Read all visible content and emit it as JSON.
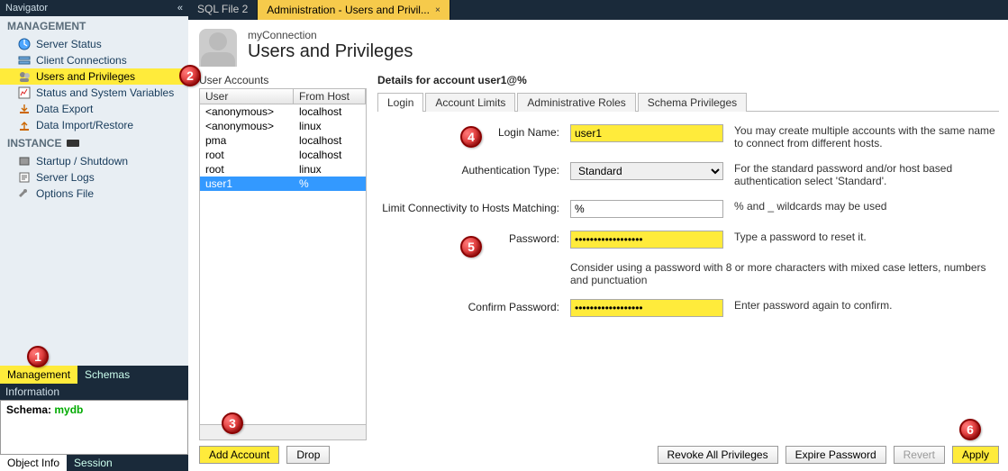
{
  "tabs": {
    "doc1": "SQL File 2",
    "doc2": "Administration - Users and Privil..."
  },
  "sidebar": {
    "title": "Navigator",
    "groups": {
      "management": "MANAGEMENT",
      "instance": "INSTANCE"
    },
    "items": {
      "server_status": "Server Status",
      "client_conn": "Client Connections",
      "users_privs": "Users and Privileges",
      "status_vars": "Status and System Variables",
      "data_export": "Data Export",
      "data_import": "Data Import/Restore",
      "startup": "Startup / Shutdown",
      "server_logs": "Server Logs",
      "options_file": "Options File"
    },
    "navtabs": {
      "management": "Management",
      "schemas": "Schemas"
    },
    "info_header": "Information",
    "info_label": "Schema:",
    "info_value": "mydb",
    "bottom": {
      "object_info": "Object Info",
      "session": "Session"
    }
  },
  "header": {
    "connection": "myConnection",
    "title": "Users and Privileges"
  },
  "accounts": {
    "label": "User Accounts",
    "columns": {
      "user": "User",
      "host": "From Host"
    },
    "rows": [
      {
        "user": "<anonymous>",
        "host": "localhost"
      },
      {
        "user": "<anonymous>",
        "host": "linux"
      },
      {
        "user": "pma",
        "host": "localhost"
      },
      {
        "user": "root",
        "host": "localhost"
      },
      {
        "user": "root",
        "host": "linux"
      },
      {
        "user": "user1",
        "host": "%"
      }
    ],
    "add_btn": "Add Account",
    "drop_btn": "Drop"
  },
  "details": {
    "title": "Details for account user1@%",
    "tabs": {
      "login": "Login",
      "limits": "Account Limits",
      "roles": "Administrative Roles",
      "schema": "Schema Privileges"
    },
    "fields": {
      "login_name": {
        "label": "Login Name:",
        "value": "user1",
        "hint": "You may create multiple accounts with the same name to connect from different hosts."
      },
      "auth_type": {
        "label": "Authentication Type:",
        "value": "Standard",
        "hint": "For the standard password and/or host based authentication select 'Standard'."
      },
      "host_match": {
        "label": "Limit Connectivity to Hosts Matching:",
        "value": "%",
        "hint": "% and _ wildcards may be used"
      },
      "password": {
        "label": "Password:",
        "value": "******************",
        "hint": "Type a password to reset it."
      },
      "password_note": "Consider using a password with 8 or more characters with mixed case letters, numbers and punctuation",
      "confirm": {
        "label": "Confirm Password:",
        "value": "******************",
        "hint": "Enter password again to confirm."
      }
    },
    "actions": {
      "revoke": "Revoke All Privileges",
      "expire": "Expire Password",
      "revert": "Revert",
      "apply": "Apply"
    }
  },
  "badges": {
    "b1": "1",
    "b2": "2",
    "b3": "3",
    "b4": "4",
    "b5": "5",
    "b6": "6"
  }
}
